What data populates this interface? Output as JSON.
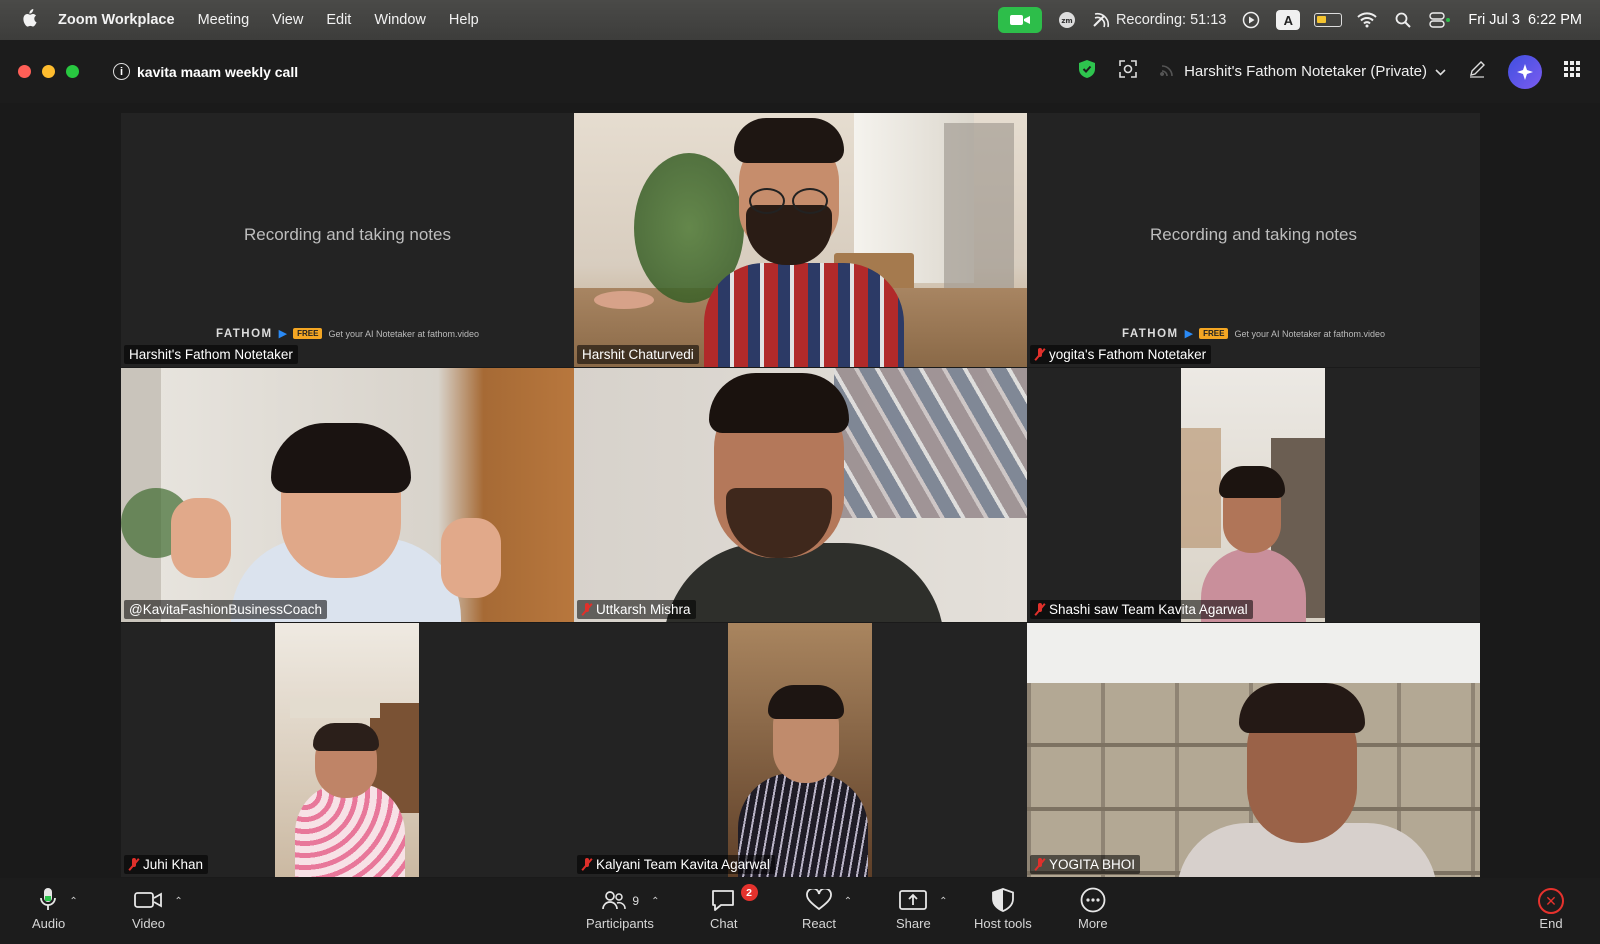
{
  "menubar": {
    "app": "Zoom Workplace",
    "items": [
      "Meeting",
      "View",
      "Edit",
      "Window",
      "Help"
    ],
    "recording": "Recording: 51:13",
    "input_source": "A",
    "datetime": "Fri Jul 3  6:22 PM"
  },
  "window": {
    "meeting_title": "kavita maam weekly call",
    "notetaker": "Harshit's Fathom Notetaker (Private)"
  },
  "fathom": {
    "recording_text": "Recording and taking notes",
    "brand": "FATHOM",
    "free": "FREE",
    "cta": "Get your AI Notetaker at fathom.video"
  },
  "participants": [
    {
      "name": "Harshit's Fathom Notetaker",
      "muted": false,
      "type": "bot"
    },
    {
      "name": "Harshit Chaturvedi",
      "muted": false,
      "type": "video",
      "active": true
    },
    {
      "name": "yogita's Fathom Notetaker",
      "muted": true,
      "type": "bot"
    },
    {
      "name": "@KavitaFashionBusinessCoach",
      "muted": false,
      "type": "video"
    },
    {
      "name": "Uttkarsh Mishra",
      "muted": true,
      "type": "video"
    },
    {
      "name": "Shashi saw Team Kavita Agarwal",
      "muted": true,
      "type": "video"
    },
    {
      "name": "Juhi Khan",
      "muted": true,
      "type": "video"
    },
    {
      "name": "Kalyani Team Kavita Agarwal",
      "muted": true,
      "type": "video"
    },
    {
      "name": "YOGITA BHOI",
      "muted": true,
      "type": "video"
    }
  ],
  "toolbar": {
    "audio": "Audio",
    "video": "Video",
    "participants": "Participants",
    "participants_count": "9",
    "chat": "Chat",
    "chat_badge": "2",
    "react": "React",
    "share": "Share",
    "host_tools": "Host tools",
    "more": "More",
    "end": "End"
  },
  "colors": {
    "active_speaker": "#2ec44e",
    "mute_red": "#e0302b",
    "end_red": "#e5322d",
    "camera_green": "#2dbe4a"
  }
}
